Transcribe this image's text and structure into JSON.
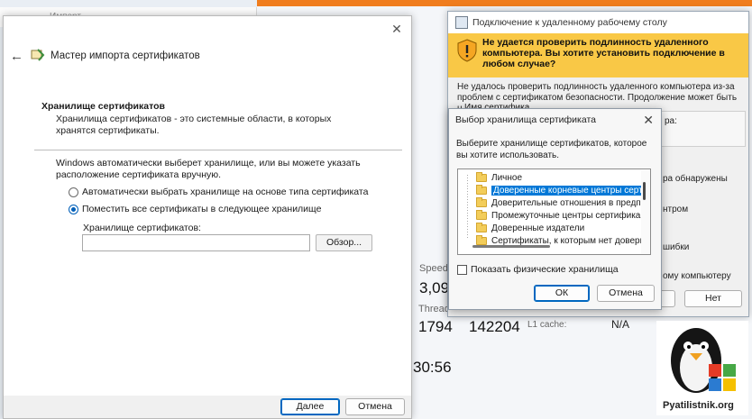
{
  "background": {
    "top_window_title": "Импорт",
    "speed_label": "Speed",
    "speed_value": "3,09",
    "threads_label": "Threads",
    "threads_value": "1794",
    "handles_value": "142204",
    "l1_label": "L1 cache:",
    "l1_value": "N/A",
    "uptime_value": "30:56",
    "accent": "#f07d1e"
  },
  "wizard": {
    "title": "Мастер импорта сертификатов",
    "section_title": "Хранилище сертификатов",
    "section_desc": "Хранилища сертификатов - это системные области, в которых хранятся сертификаты.",
    "info": "Windows автоматически выберет хранилище, или вы можете указать расположение сертификата вручную.",
    "radio_auto": "Автоматически выбрать хранилище на основе типа сертификата",
    "radio_manual": "Поместить все сертификаты в следующее хранилище",
    "store_label": "Хранилище сертификатов:",
    "store_value": "",
    "browse": "Обзор...",
    "next": "Далее",
    "cancel": "Отмена"
  },
  "rdp": {
    "title": "Подключение к удаленному рабочему столу",
    "warning": "Не удается проверить подлинность удаленного компьютера. Вы хотите установить подключение в любом случае?",
    "desc": "Не удалось проверить подлинность удаленного компьютера из-за проблем с сертификатом безопасности. Продолжение может быть небезопасным.",
    "name_label": "Имя сертифика",
    "frag_1": "ра:",
    "frag_2": "ра обнаружены",
    "frag_3": "нтром",
    "frag_4": "шибки",
    "frag_5": "ому компьютеру",
    "yes": "Да",
    "no": "Нет",
    "warn_color": "#f9c846"
  },
  "store_dialog": {
    "title": "Выбор хранилища сертификата",
    "prompt": "Выберите хранилище сертификатов, которое вы хотите использовать.",
    "items": [
      "Личное",
      "Доверенные корневые центры сертиф",
      "Доверительные отношения в предпри",
      "Промежуточные центры сертификаци",
      "Доверенные издатели",
      "Сертификаты, к которым нет довери"
    ],
    "selected_index": 1,
    "show_physical": "Показать физические хранилища",
    "ok": "ОК",
    "cancel": "Отмена"
  },
  "watermark": {
    "text": "Pyatilistnik.org"
  }
}
